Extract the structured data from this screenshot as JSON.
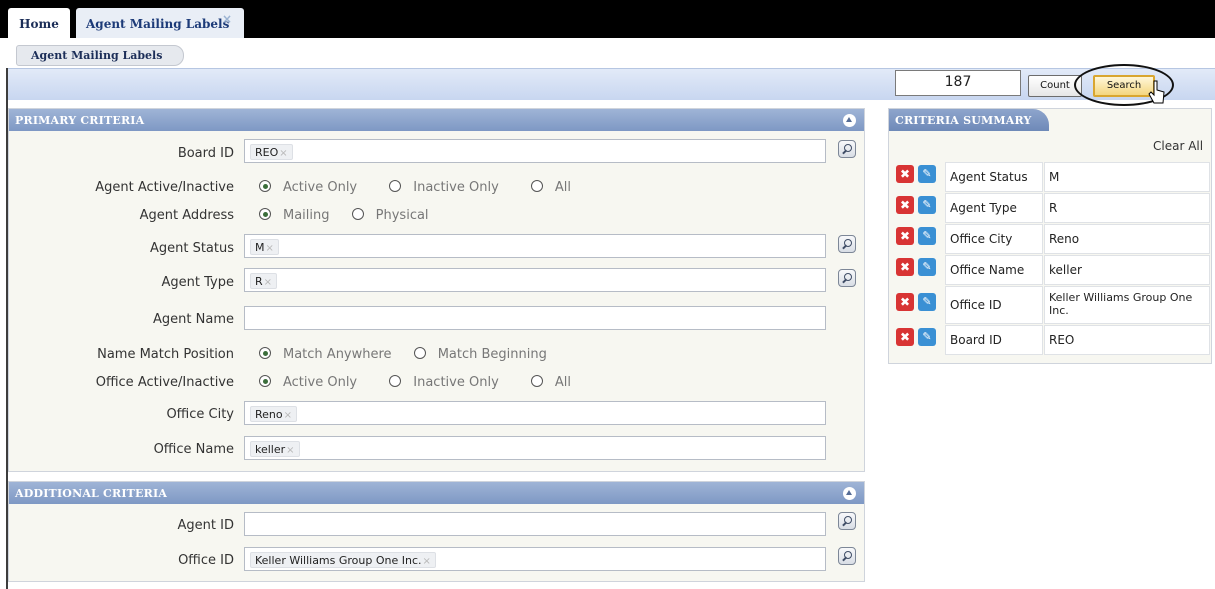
{
  "tabs": {
    "home": "Home",
    "active": "Agent Mailing Labels",
    "close": "×"
  },
  "subtab": "Agent Mailing Labels",
  "toolbar": {
    "count_value": "187",
    "count_label": "Count",
    "search_label": "Search"
  },
  "primary": {
    "header": "PRIMARY CRITERIA",
    "board_id": {
      "label": "Board ID",
      "tokens": [
        "REO"
      ]
    },
    "agent_active": {
      "label": "Agent Active/Inactive",
      "options": [
        "Active Only",
        "Inactive Only",
        "All"
      ],
      "selected": "Active Only"
    },
    "agent_address": {
      "label": "Agent Address",
      "options": [
        "Mailing",
        "Physical"
      ],
      "selected": "Mailing"
    },
    "agent_status": {
      "label": "Agent Status",
      "tokens": [
        "M"
      ]
    },
    "agent_type": {
      "label": "Agent Type",
      "tokens": [
        "R"
      ]
    },
    "agent_name": {
      "label": "Agent Name",
      "value": ""
    },
    "name_match": {
      "label": "Name Match Position",
      "options": [
        "Match Anywhere",
        "Match Beginning"
      ],
      "selected": "Match Anywhere"
    },
    "office_active": {
      "label": "Office Active/Inactive",
      "options": [
        "Active Only",
        "Inactive Only",
        "All"
      ],
      "selected": "Active Only"
    },
    "office_city": {
      "label": "Office City",
      "tokens": [
        "Reno"
      ]
    },
    "office_name": {
      "label": "Office Name",
      "tokens": [
        "keller"
      ]
    }
  },
  "additional": {
    "header": "ADDITIONAL CRITERIA",
    "agent_id": {
      "label": "Agent ID",
      "value": ""
    },
    "office_id": {
      "label": "Office ID",
      "tokens": [
        "Keller Williams Group One Inc."
      ]
    }
  },
  "summary": {
    "header": "CRITERIA SUMMARY",
    "clear_all": "Clear All",
    "rows": [
      {
        "name": "Agent Status",
        "value": "M"
      },
      {
        "name": "Agent Type",
        "value": "R"
      },
      {
        "name": "Office City",
        "value": "Reno"
      },
      {
        "name": "Office Name",
        "value": "keller"
      },
      {
        "name": "Office ID",
        "value": "Keller Williams Group One Inc."
      },
      {
        "name": "Board ID",
        "value": "REO"
      }
    ]
  },
  "icons": {
    "token_remove": "×",
    "delete": "✖",
    "edit": "✎"
  },
  "colors": {
    "header_blue": "#7e98c4",
    "band_blue": "#c8d6f0",
    "delete_red": "#d83434",
    "edit_blue": "#3a90d4",
    "search_highlight": "#f4d680"
  }
}
